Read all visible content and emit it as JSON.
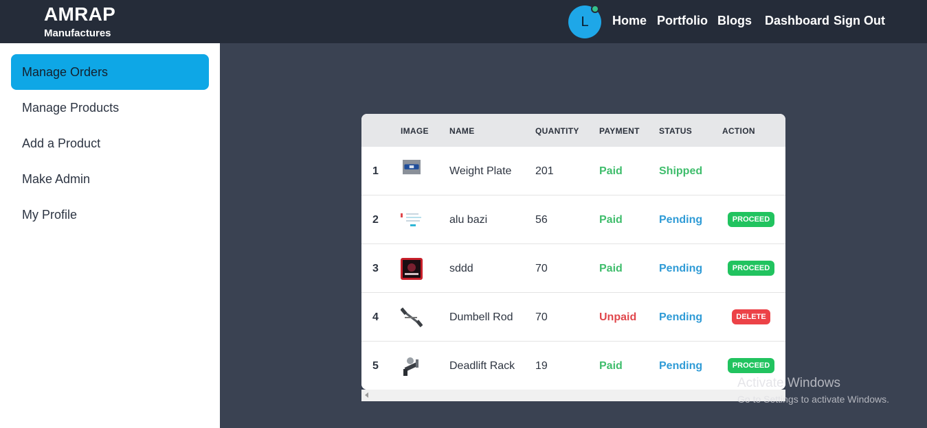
{
  "brand": {
    "title": "AMRAP",
    "subtitle": "Manufactures"
  },
  "header": {
    "avatar_letter": "L",
    "nav": [
      "Home",
      "Portfolio",
      "Blogs",
      "Dashboard",
      "Sign Out"
    ]
  },
  "sidebar": {
    "items": [
      {
        "label": "Manage Orders",
        "active": true
      },
      {
        "label": "Manage Products"
      },
      {
        "label": "Add a Product"
      },
      {
        "label": "Make Admin"
      },
      {
        "label": "My Profile"
      }
    ]
  },
  "table": {
    "headers": [
      "IMAGE",
      "NAME",
      "QUANTITY",
      "PAYMENT",
      "STATUS",
      "ACTION"
    ],
    "rows": [
      {
        "index": "1",
        "image": "weight-plate-thumb",
        "name": "Weight Plate",
        "quantity": "201",
        "payment": "Paid",
        "status": "Shipped",
        "action": ""
      },
      {
        "index": "2",
        "image": "alu-bazi-thumb",
        "name": "alu bazi",
        "quantity": "56",
        "payment": "Paid",
        "status": "Pending",
        "action": "PROCEED"
      },
      {
        "index": "3",
        "image": "sddd-thumb",
        "name": "sddd",
        "quantity": "70",
        "payment": "Paid",
        "status": "Pending",
        "action": "PROCEED"
      },
      {
        "index": "4",
        "image": "dumbell-rod-thumb",
        "name": "Dumbell Rod",
        "quantity": "70",
        "payment": "Unpaid",
        "status": "Pending",
        "action": "DELETE"
      },
      {
        "index": "5",
        "image": "deadlift-rack-thumb",
        "name": "Deadlift Rack",
        "quantity": "19",
        "payment": "Paid",
        "status": "Pending",
        "action": "PROCEED"
      }
    ]
  },
  "watermark": {
    "line1": "Activate Windows",
    "line2": "Go to Settings to activate Windows."
  },
  "colors": {
    "topbar": "#252c39",
    "content_bg": "#3a4252",
    "active_sidebar": "#0ea7e6",
    "paid": "#3fbd6c",
    "unpaid": "#e0474c",
    "pending": "#2f9bd6",
    "proceed_badge": "#21c35f",
    "delete_badge": "#ec4247"
  }
}
